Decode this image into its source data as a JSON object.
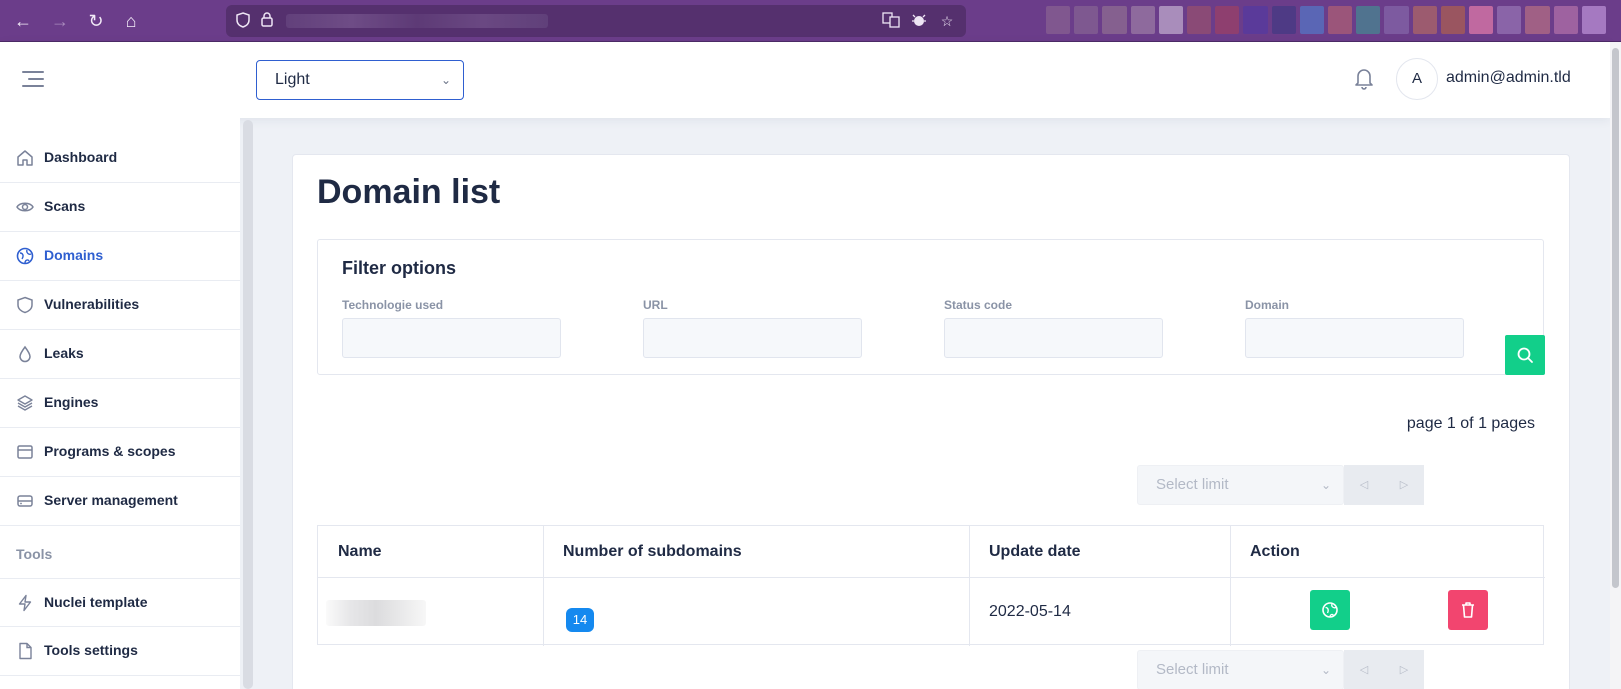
{
  "browser": {
    "extension_colors": [
      "#80578f",
      "#7e5890",
      "#85608f",
      "#8e6a9d",
      "#a98dbb",
      "#8a4a76",
      "#8e3f6f",
      "#5a3a9a",
      "#4e3a85",
      "#5a66b5",
      "#9b557a",
      "#50738f",
      "#7d5aa0",
      "#9c5b6f",
      "#9a5560",
      "#c069a0",
      "#8a64a8",
      "#a06085",
      "#9e62a0",
      "#a579c1"
    ]
  },
  "header": {
    "theme_select": "Light",
    "avatar_initial": "A",
    "user_email": "admin@admin.tld"
  },
  "sidebar": {
    "items": [
      {
        "label": "Dashboard",
        "icon": "home-icon"
      },
      {
        "label": "Scans",
        "icon": "eye-icon"
      },
      {
        "label": "Domains",
        "icon": "globe-icon"
      },
      {
        "label": "Vulnerabilities",
        "icon": "shield-icon"
      },
      {
        "label": "Leaks",
        "icon": "droplet-icon"
      },
      {
        "label": "Engines",
        "icon": "layers-icon"
      },
      {
        "label": "Programs & scopes",
        "icon": "browser-icon"
      },
      {
        "label": "Server management",
        "icon": "server-icon"
      }
    ],
    "active_item": "Domains",
    "section_tools": "Tools",
    "tools": [
      {
        "label": "Nuclei template",
        "icon": "lightning-icon"
      },
      {
        "label": "Tools settings",
        "icon": "file-icon"
      }
    ]
  },
  "main": {
    "title": "Domain list",
    "filter": {
      "title": "Filter options",
      "fields": [
        {
          "label": "Technologie used",
          "value": ""
        },
        {
          "label": "URL",
          "value": ""
        },
        {
          "label": "Status code",
          "value": ""
        },
        {
          "label": "Domain",
          "value": ""
        }
      ]
    },
    "pagination": {
      "info": "page 1 of 1 pages",
      "limit_placeholder": "Select limit"
    },
    "table": {
      "headers": [
        "Name",
        "Number of subdomains",
        "Update date",
        "Action"
      ],
      "rows": [
        {
          "name": "",
          "subdomains": "14",
          "update_date": "2022-05-14"
        }
      ]
    }
  },
  "colors": {
    "accent": "#2f5fd0",
    "success": "#12cf8a",
    "danger": "#f2456f",
    "badge": "#1589ef"
  }
}
